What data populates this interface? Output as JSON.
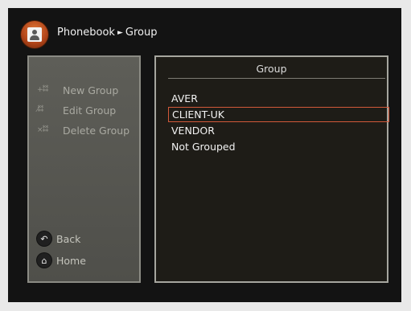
{
  "header": {
    "section": "Phonebook",
    "arrow": "►",
    "page": "Group"
  },
  "left_menu": {
    "items": [
      {
        "icon": "add-group-icon",
        "glyph": "+⁑⁑",
        "label": "New Group"
      },
      {
        "icon": "edit-group-icon",
        "glyph": "⁄⁑⁑",
        "label": "Edit Group"
      },
      {
        "icon": "delete-group-icon",
        "glyph": "×⁑⁑",
        "label": "Delete Group"
      }
    ],
    "nav": [
      {
        "icon": "back-icon",
        "glyph": "↶",
        "label": "Back"
      },
      {
        "icon": "home-icon",
        "glyph": "⌂",
        "label": "Home"
      }
    ]
  },
  "group_panel": {
    "title": "Group",
    "items": [
      "AVER",
      "CLIENT-UK",
      "VENDOR",
      "Not Grouped"
    ],
    "selected_index": 1
  },
  "colors": {
    "selection_border": "#d2593a",
    "logo_accent": "#c4541f"
  }
}
